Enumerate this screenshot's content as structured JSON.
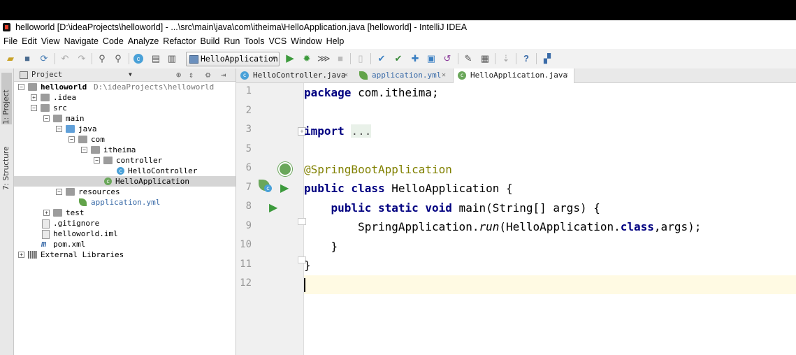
{
  "window": {
    "title": "helloworld [D:\\ideaProjects\\helloworld] - ...\\src\\main\\java\\com\\itheima\\HelloApplication.java [helloworld] - IntelliJ IDEA"
  },
  "menu": [
    "File",
    "Edit",
    "View",
    "Navigate",
    "Code",
    "Analyze",
    "Refactor",
    "Build",
    "Run",
    "Tools",
    "VCS",
    "Window",
    "Help"
  ],
  "toolbar": {
    "run_config": "HelloApplication",
    "help_glyph": "?"
  },
  "side_tabs": {
    "project": "1: Project",
    "structure": "7: Structure"
  },
  "project_panel": {
    "header": "Project",
    "tree": [
      {
        "label": "helloworld",
        "path": "D:\\ideaProjects\\helloworld"
      },
      {
        "label": ".idea"
      },
      {
        "label": "src"
      },
      {
        "label": "main"
      },
      {
        "label": "java"
      },
      {
        "label": "com"
      },
      {
        "label": "itheima"
      },
      {
        "label": "controller"
      },
      {
        "label": "HelloController"
      },
      {
        "label": "HelloApplication"
      },
      {
        "label": "resources"
      },
      {
        "label": "application.yml"
      },
      {
        "label": "test"
      },
      {
        "label": ".gitignore"
      },
      {
        "label": "helloworld.iml"
      },
      {
        "label": "pom.xml"
      },
      {
        "label": "External Libraries"
      }
    ]
  },
  "editor": {
    "tabs": [
      {
        "label": "HelloController.java",
        "icon": "class-icon"
      },
      {
        "label": "application.yml",
        "icon": "spring-leaf-icon"
      },
      {
        "label": "HelloApplication.java",
        "icon": "spring-class-icon",
        "active": true
      }
    ],
    "line_numbers": [
      "1",
      "2",
      "3",
      "5",
      "6",
      "7",
      "8",
      "9",
      "10",
      "11",
      "12"
    ],
    "code": {
      "l1_kw": "package",
      "l1_rest": " com.itheima;",
      "l3_kw": "import",
      "l3_dots": "...",
      "l6_ann": "@SpringBootApplication",
      "l7_kw": "public class",
      "l7_rest": " HelloApplication {",
      "l8_kw": "public static void",
      "l8_rest": " main(String[] args) {",
      "l9_a": "SpringApplication.",
      "l9_run": "run",
      "l9_b": "(HelloApplication.",
      "l9_class": "class",
      "l9_c": ",args);",
      "l10": "}",
      "l11": "}"
    }
  },
  "colors": {
    "keyword": "#000080",
    "annotation": "#808000",
    "current_line": "#fffae3",
    "gutter": "#f0f0f0",
    "run_green": "#3c9a3c"
  }
}
